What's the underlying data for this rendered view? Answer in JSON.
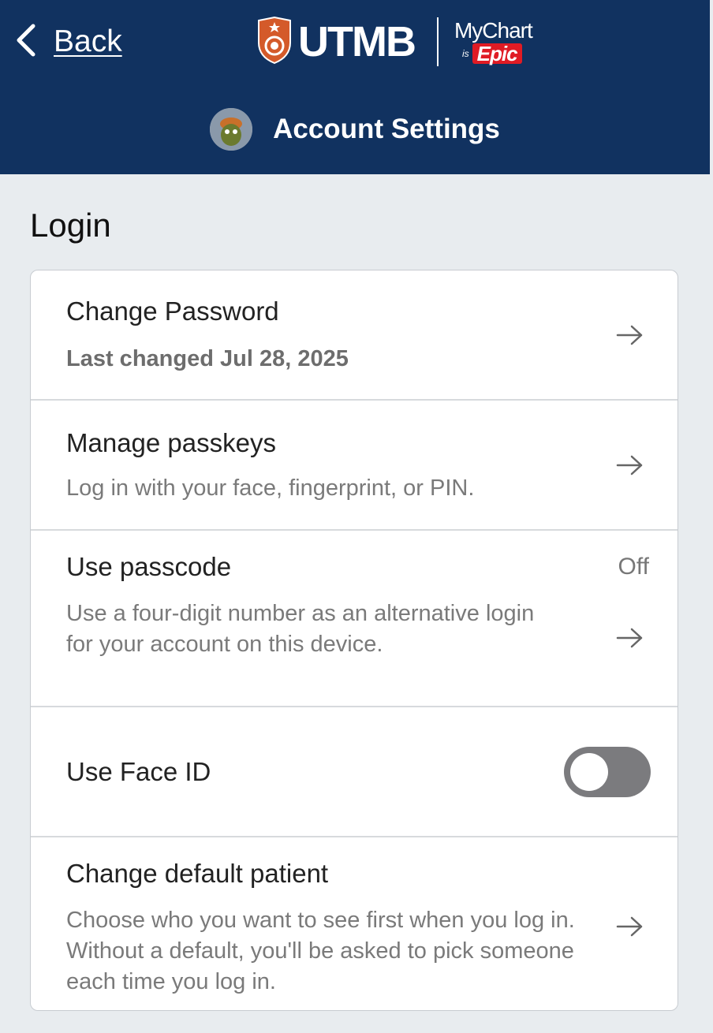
{
  "header": {
    "back_label": "Back",
    "brand": "UTMB",
    "partner_line1": "MyChart",
    "partner_is": "is",
    "partner_epic": "Epic",
    "page_title": "Account Settings"
  },
  "colors": {
    "header_bg": "#113260",
    "page_bg": "#e8ecef",
    "shield_orange": "#d45a2a",
    "epic_red": "#e01b24",
    "toggle_off": "#7b7b7e"
  },
  "section": {
    "title": "Login",
    "rows": [
      {
        "title": "Change Password",
        "subtitle": "Last changed Jul 28, 2025",
        "icon": "arrow-right-icon"
      },
      {
        "title": "Manage passkeys",
        "subtitle": "Log in with your face, fingerprint, or PIN.",
        "icon": "arrow-right-icon"
      },
      {
        "title": "Use passcode",
        "value": "Off",
        "subtitle": "Use a four-digit number as an alternative login for your account on this device.",
        "icon": "arrow-right-icon"
      },
      {
        "title": "Use Face ID",
        "toggle_on": false
      },
      {
        "title": "Change default patient",
        "subtitle": "Choose who you want to see first when you log in. Without a default, you'll be asked to pick someone each time you log in.",
        "icon": "arrow-right-icon"
      }
    ]
  }
}
